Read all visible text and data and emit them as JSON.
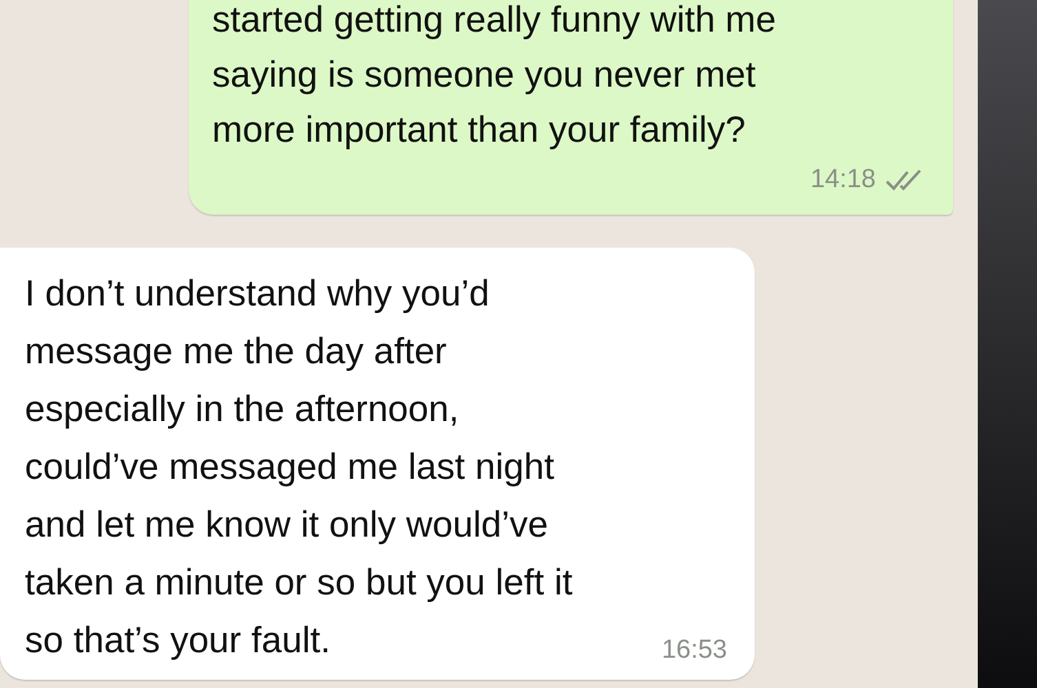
{
  "messages": [
    {
      "kind": "sent",
      "lines": [
        "started getting really funny with me",
        "saying is someone you never met",
        "more important than your family?"
      ],
      "time": "14:18",
      "read": false
    },
    {
      "kind": "received",
      "lines": [
        "I don’t understand why you’d",
        "message me the day after",
        "especially in the afternoon,",
        "could’ve messaged me last night",
        "and let me know it only would’ve",
        "taken a minute or so but you left it",
        "so that’s your fault."
      ],
      "time": "16:53"
    }
  ]
}
